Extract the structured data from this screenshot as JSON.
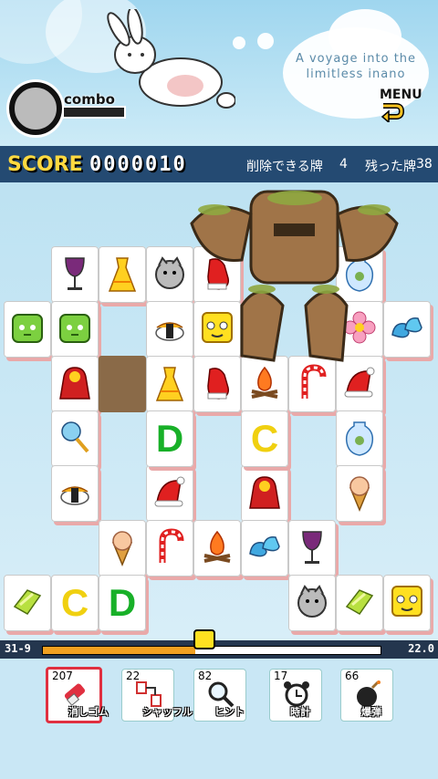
{
  "header": {
    "combo_label": "combo",
    "voyage_text": "A voyage into the limitless inano",
    "menu_label": "MENU"
  },
  "scorebar": {
    "score_label": "SCORE",
    "score_value": "0000010",
    "removable_label": "削除できる牌",
    "removable_value": "4",
    "remaining_label": "残った牌",
    "remaining_value": "38"
  },
  "board": {
    "tiles": [
      {
        "icon": "wine-glass-icon"
      },
      {
        "icon": "yellow-dress-icon"
      },
      {
        "icon": "gray-cat-face-icon"
      },
      {
        "icon": "red-mitten-icon"
      },
      {
        "icon": "blue-vase-icon"
      },
      {
        "icon": "green-slime-icon"
      },
      {
        "icon": "green-slime-icon"
      },
      {
        "icon": "sushi-icon"
      },
      {
        "icon": "yellow-cube-face-icon"
      },
      {
        "icon": "pink-flower-icon"
      },
      {
        "icon": "blue-slippers-icon"
      },
      {
        "icon": "red-cloak-icon"
      },
      {
        "icon": "yellow-dress-icon"
      },
      {
        "icon": "red-mitten-icon"
      },
      {
        "icon": "campfire-icon"
      },
      {
        "icon": "candy-cane-icon"
      },
      {
        "icon": "santa-hat-icon"
      },
      {
        "icon": "magic-wand-icon"
      },
      {
        "icon": "blue-vase-icon"
      },
      {
        "icon": "sushi-icon"
      },
      {
        "icon": "santa-hat-icon"
      },
      {
        "icon": "red-cloak-icon"
      },
      {
        "icon": "ice-cream-icon"
      },
      {
        "icon": "ice-cream-icon"
      },
      {
        "icon": "candy-cane-icon"
      },
      {
        "icon": "campfire-icon"
      },
      {
        "icon": "blue-slippers-icon"
      },
      {
        "icon": "wine-glass-icon"
      },
      {
        "icon": "green-gem-icon"
      },
      {
        "icon": "gray-cat-face-icon"
      },
      {
        "icon": "green-gem-icon"
      },
      {
        "icon": "yellow-cube-face-icon"
      }
    ],
    "letter_tiles": [
      "D",
      "C",
      "C",
      "D"
    ]
  },
  "progress": {
    "left_label": "31-9",
    "right_label": "22.0",
    "fill": 0.45
  },
  "tools": [
    {
      "count": "207",
      "label": "消しゴム",
      "icon": "eraser-icon",
      "selected": true
    },
    {
      "count": "22",
      "label": "シャッフル",
      "icon": "shuffle-icon",
      "selected": false
    },
    {
      "count": "82",
      "label": "ヒント",
      "icon": "magnifier-icon",
      "selected": false
    },
    {
      "count": "17",
      "label": "時計",
      "icon": "alarm-clock-icon",
      "selected": false
    },
    {
      "count": "66",
      "label": "爆弾",
      "icon": "bomb-icon",
      "selected": false
    }
  ],
  "colors": {
    "score_yellow": "#ffd940",
    "scorebar_bg": "#244a72",
    "progress_fill": "#f0a020",
    "selected_tool_border": "#e03040",
    "tile_shadow": "#e9a9a9"
  }
}
